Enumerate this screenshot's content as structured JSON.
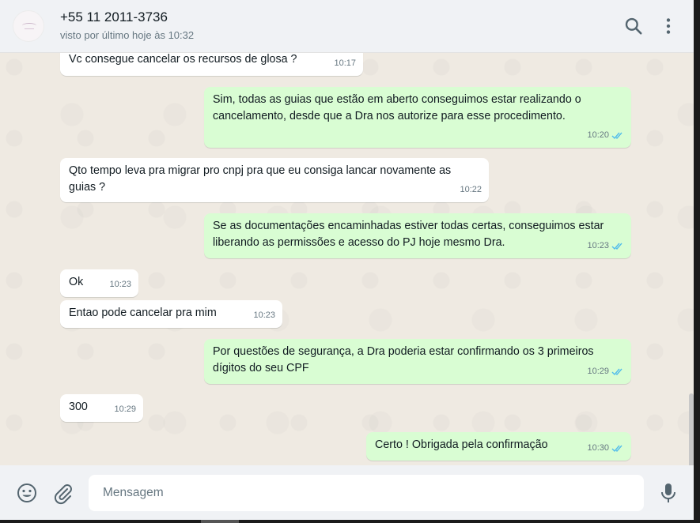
{
  "header": {
    "contact": "+55 11 2011-3736",
    "status": "visto por último hoje às 10:32"
  },
  "messages": [
    {
      "dir": "in",
      "text": "Vc consegue cancelar os recursos de glosa ?",
      "time": "10:17"
    },
    {
      "dir": "out",
      "text": "Sim, todas as guias que estão em aberto conseguimos estar realizando o cancelamento, desde que a Dra nos autorize para esse procedimento.",
      "time": "10:20",
      "status": "read"
    },
    {
      "dir": "in",
      "text": "Qto tempo leva pra migrar pro cnpj pra que eu consiga lancar novamente as guias ?",
      "time": "10:22"
    },
    {
      "dir": "out",
      "text": "Se as documentações encaminhadas estiver todas certas, conseguimos estar liberando as permissões e acesso do PJ hoje mesmo Dra.",
      "time": "10:23",
      "status": "read"
    },
    {
      "dir": "in",
      "text": "Ok",
      "time": "10:23"
    },
    {
      "dir": "in",
      "text": "Entao pode cancelar pra mim",
      "time": "10:23"
    },
    {
      "dir": "out",
      "text": "Por questões de segurança, a Dra poderia estar confirmando os 3 primeiros dígitos do seu CPF",
      "time": "10:29",
      "status": "read"
    },
    {
      "dir": "in",
      "text": "300",
      "time": "10:29"
    },
    {
      "dir": "out",
      "text": "Certo ! Obrigada pela confirmação",
      "time": "10:30",
      "status": "read"
    }
  ],
  "composer": {
    "placeholder": "Mensagem"
  },
  "icons": {
    "search": "search-icon",
    "menu": "menu-icon",
    "emoji": "emoji-icon",
    "attach": "attach-icon",
    "mic": "mic-icon",
    "read_receipt": "double-check-icon"
  },
  "colors": {
    "incoming_bubble": "#ffffff",
    "outgoing_bubble": "#d9fdd3",
    "read_tick": "#53bdeb",
    "chat_background": "#efeae2"
  }
}
